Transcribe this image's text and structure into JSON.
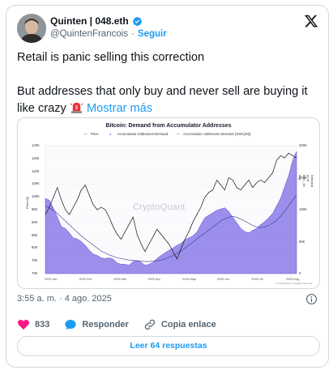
{
  "author": {
    "name": "Quinten | 048.eth",
    "handle": "@QuintenFrancois",
    "follow_label": "Seguir",
    "separator": "·"
  },
  "tweet": {
    "line1": "Retail is panic selling this correction",
    "line2": "But addresses that only buy and never sell are buying it like crazy",
    "more_label": "Mostrar más"
  },
  "meta": {
    "time": "3:55 a. m.",
    "separator": "·",
    "date": "4 ago. 2025"
  },
  "actions": {
    "likes": "833",
    "reply_label": "Responder",
    "copy_label": "Copia enlace"
  },
  "replies_button": "Leer 64 respuestas",
  "colors": {
    "accent": "#1d9bf0",
    "like": "#f91880",
    "area": "#8b7be8",
    "text": "#0f1419",
    "muted": "#536471"
  },
  "icons": {
    "verified": "verified-badge-icon",
    "x_logo": "x-logo-icon",
    "alarm": "police-light-emoji",
    "info": "info-icon",
    "like": "heart-icon",
    "reply": "speech-bubble-icon",
    "copy": "link-icon"
  },
  "chart_data": {
    "type": "line",
    "title": "Bitcoin: Demand from Accumulator Addresses",
    "legend": [
      "Price",
      "Accumulator Addresses Demand",
      "Accumulator Addresses Demand (SMA(30))"
    ],
    "watermark": "CryptoQuant",
    "credit": "© CryptoQuant. All rights reserved.",
    "left_axis_label": "Price ($)",
    "right_axis_label": "Demand (# of BTC, 30 day change)",
    "left_ticks": [
      "120K",
      "115K",
      "110K",
      "105K",
      "100K",
      "95K",
      "90K",
      "85K",
      "80K",
      "75K",
      "70K"
    ],
    "right_ticks": [
      "320K",
      "240K",
      "160K",
      "80K",
      "0"
    ],
    "x_ticks": [
      "2025 Jan",
      "2025 Feb",
      "2025 Mar",
      "2025 Apr",
      "2025 May",
      "2025 Jun",
      "2025 Jul",
      "2025 Aug"
    ],
    "ylim_left": [
      70000,
      122000
    ],
    "ylim_right": [
      0,
      340000
    ],
    "series": [
      {
        "name": "Price",
        "axis": "left",
        "values": [
          94000,
          97000,
          101000,
          105000,
          100000,
          96000,
          94000,
          97000,
          100000,
          104000,
          106000,
          102000,
          98000,
          96000,
          97000,
          96000,
          93000,
          89000,
          86000,
          84000,
          87000,
          90000,
          93000,
          86000,
          82000,
          79000,
          82000,
          85000,
          88000,
          86000,
          84000,
          82000,
          79000,
          76000,
          80000,
          84000,
          87000,
          91000,
          94000,
          97000,
          101000,
          103000,
          104000,
          108000,
          106000,
          104000,
          109000,
          108000,
          105000,
          104000,
          106000,
          108000,
          105000,
          107000,
          108000,
          107000,
          109000,
          111000,
          116000,
          118000,
          117000,
          119000,
          118000,
          117000
        ]
      },
      {
        "name": "Accumulator Addresses Demand",
        "axis": "right",
        "values": [
          200000,
          195000,
          175000,
          150000,
          125000,
          120000,
          108000,
          95000,
          92000,
          85000,
          75000,
          62000,
          52000,
          48000,
          42000,
          40000,
          42000,
          38000,
          28000,
          25000,
          25000,
          22000,
          32000,
          35000,
          30000,
          22000,
          25000,
          30000,
          40000,
          48000,
          55000,
          62000,
          68000,
          75000,
          80000,
          90000,
          95000,
          100000,
          110000,
          130000,
          148000,
          155000,
          162000,
          168000,
          172000,
          175000,
          165000,
          150000,
          135000,
          120000,
          112000,
          108000,
          115000,
          120000,
          130000,
          138000,
          148000,
          160000,
          180000,
          200000,
          230000,
          260000,
          300000,
          325000
        ]
      },
      {
        "name": "Accumulator Addresses Demand (SMA(30))",
        "axis": "right",
        "values": [
          180000,
          175000,
          168000,
          160000,
          150000,
          140000,
          130000,
          120000,
          110000,
          100000,
          92000,
          84000,
          76000,
          68000,
          60000,
          55000,
          50000,
          46000,
          42000,
          40000,
          38000,
          36000,
          35000,
          34000,
          33000,
          32000,
          32000,
          33000,
          34000,
          36000,
          39000,
          43000,
          48000,
          54000,
          60000,
          68000,
          76000,
          84000,
          92000,
          100000,
          108000,
          116000,
          124000,
          132000,
          140000,
          146000,
          150000,
          152000,
          150000,
          145000,
          140000,
          134000,
          128000,
          124000,
          122000,
          124000,
          128000,
          134000,
          142000,
          152000,
          165000,
          180000,
          195000,
          210000
        ]
      }
    ]
  }
}
